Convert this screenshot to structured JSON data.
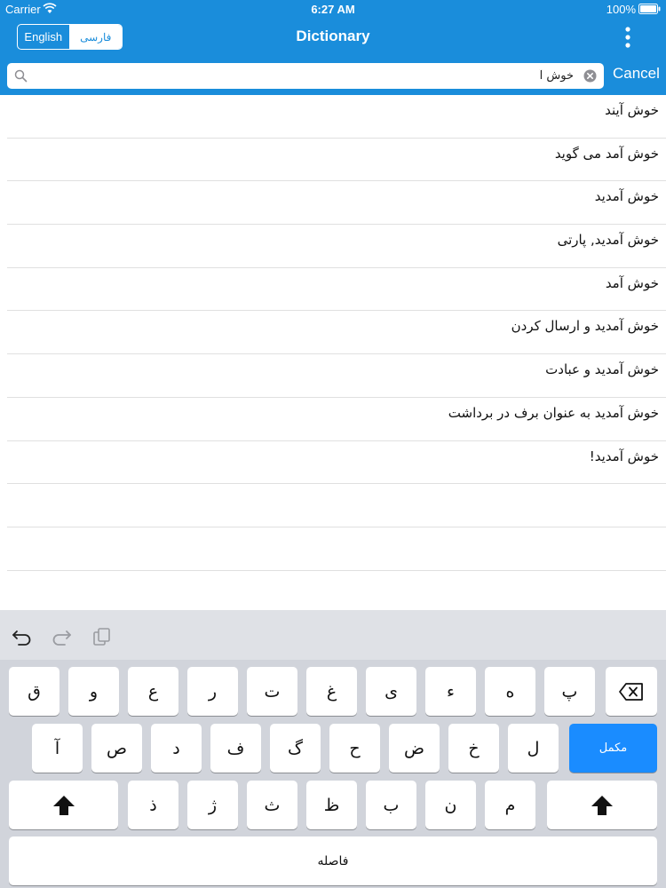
{
  "status": {
    "carrier": "Carrier",
    "time": "6:27 AM",
    "battery": "100%"
  },
  "nav": {
    "title": "Dictionary",
    "segments": [
      {
        "label": "English",
        "selected": false
      },
      {
        "label": "فارسی",
        "selected": true
      }
    ]
  },
  "search": {
    "value": "خوش آ",
    "cancel_label": "Cancel"
  },
  "results": [
    "خوش آیند",
    "خوش آمد می گوید",
    "خوش آمدید",
    "خوش آمدید, پارتی",
    "خوش آمد",
    "خوش آمدید و ارسال کردن",
    "خوش آمدید و عبادت",
    "خوش آمدید به عنوان برف در برداشت",
    "خوش آمدید!"
  ],
  "keyboard": {
    "row1": [
      "ق",
      "و",
      "ع",
      "ر",
      "ت",
      "غ",
      "ی",
      "ء",
      "ه",
      "پ"
    ],
    "row2": [
      "آ",
      "ص",
      "د",
      "ف",
      "گ",
      "ح",
      "ض",
      "خ",
      "ل"
    ],
    "row3": [
      "ذ",
      "ژ",
      "ث",
      "ظ",
      "ب",
      "ن",
      "م"
    ],
    "complete_label": "مکمل",
    "space_label": "فاصله"
  },
  "colors": {
    "header_blue": "#1a8ddb",
    "key_blue": "#1a8cff"
  }
}
